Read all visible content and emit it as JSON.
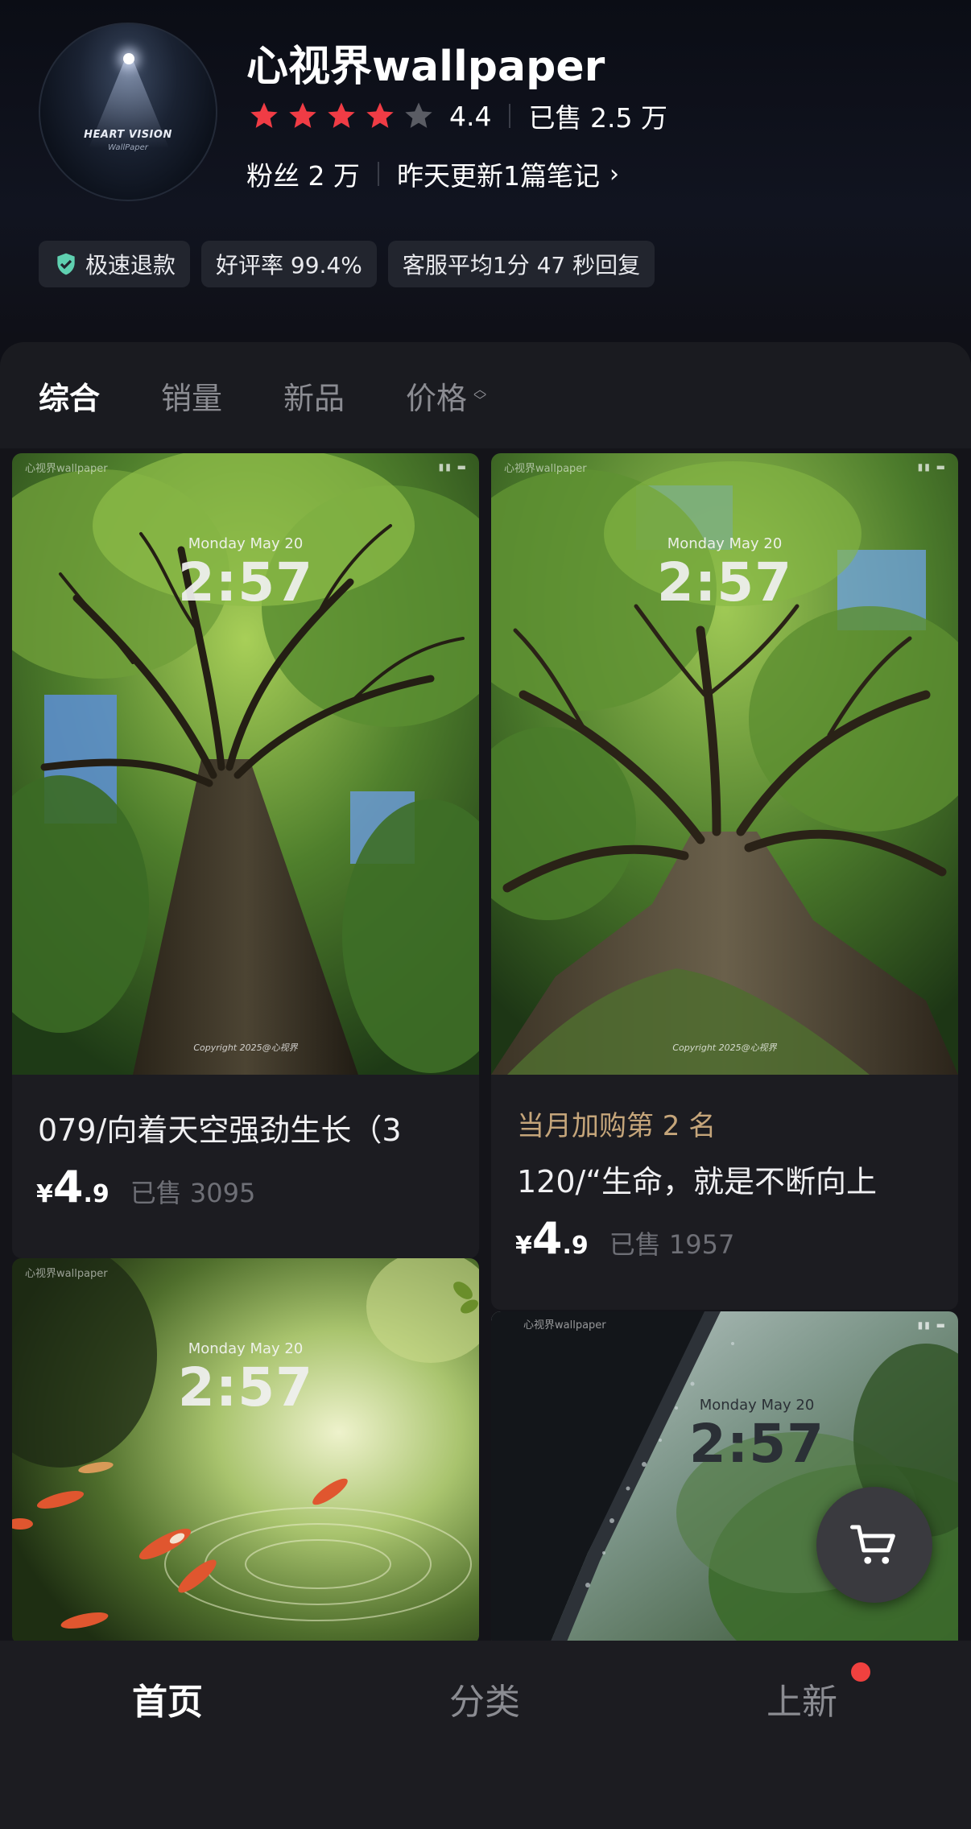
{
  "shop": {
    "name": "心视界wallpaper",
    "avatar_brand": "HEART VISION",
    "avatar_sub": "WallPaper",
    "rating": "4.4",
    "stars_filled": 4,
    "stars_total": 5,
    "sold_total": "已售 2.5 万",
    "fans": "粉丝 2 万",
    "update": "昨天更新1篇笔记",
    "badges": [
      "极速退款",
      "好评率 99.4%",
      "客服平均1分 47 秒回复"
    ]
  },
  "sort_tabs": [
    "综合",
    "销量",
    "新品",
    "价格"
  ],
  "lockscreen": {
    "watermark": "心视界wallpaper",
    "date": "Monday May 20",
    "time": "2:57",
    "copyright": "Copyright 2025@心视界"
  },
  "products": [
    {
      "title": "079/向着天空强劲生长（3",
      "price_currency": "¥",
      "price_int": "4",
      "price_dec": ".9",
      "sold": "已售 3095"
    },
    {
      "rank": "当月加购第 2 名",
      "title": "120/“生命，就是不断向上",
      "price_currency": "¥",
      "price_int": "4",
      "price_dec": ".9",
      "sold": "已售 1957"
    }
  ],
  "bottom_nav": [
    "首页",
    "分类",
    "上新"
  ],
  "colors": {
    "accent_red": "#f0413f",
    "star_red": "#f03c45",
    "rank_gold": "#c5a57a",
    "background": "#141419"
  }
}
